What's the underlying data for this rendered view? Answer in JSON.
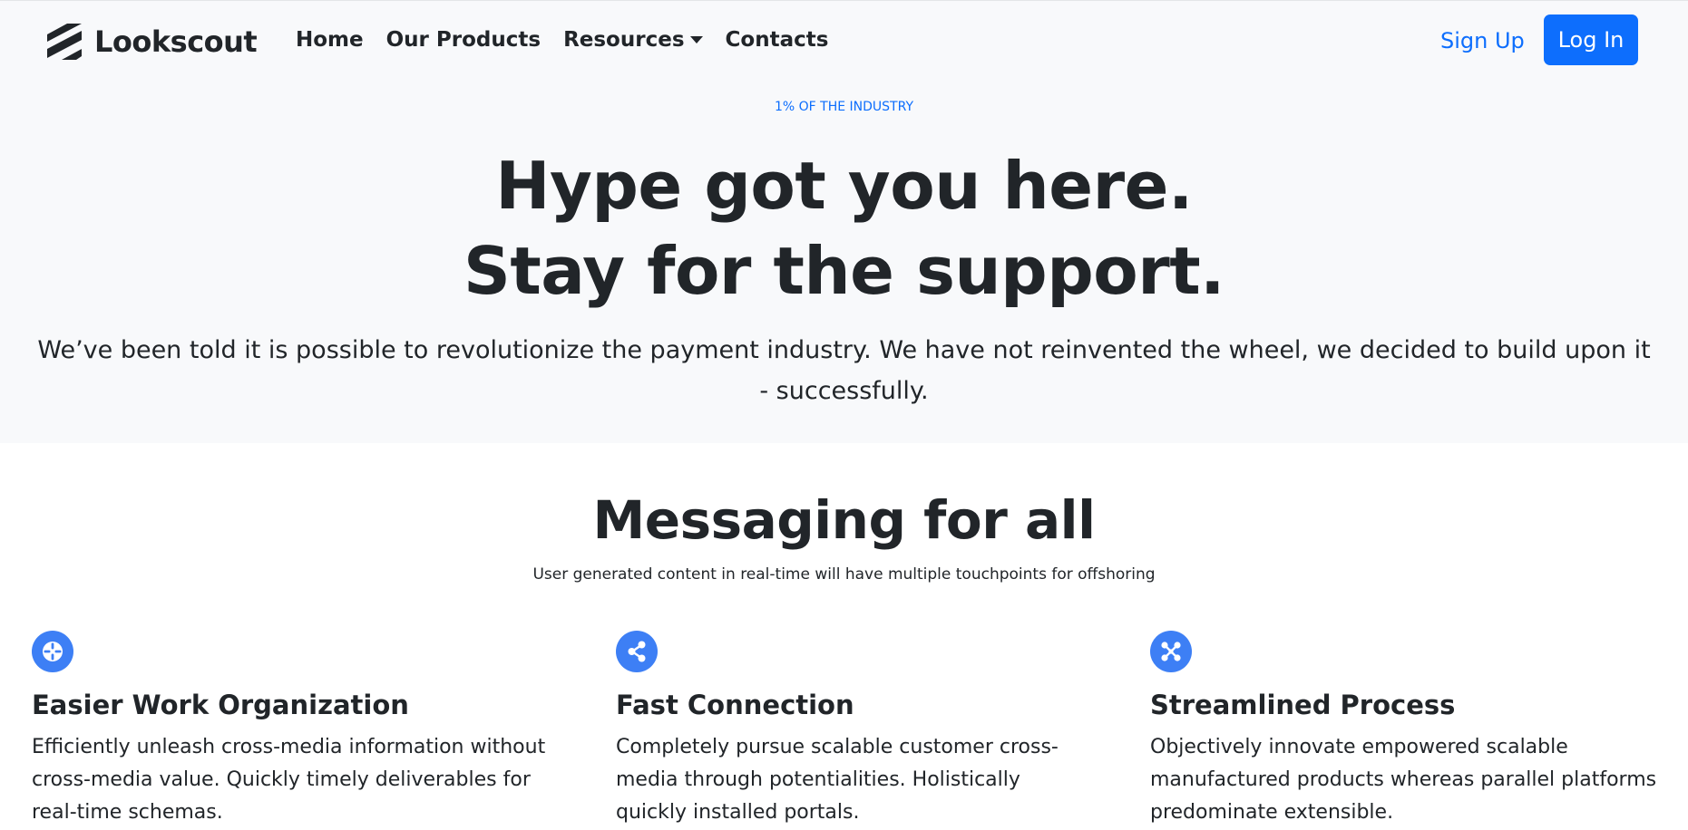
{
  "brand": {
    "name": "Lookscout",
    "logo_icon": "stripes-logo-icon"
  },
  "nav": {
    "items": [
      {
        "label": "Home"
      },
      {
        "label": "Our Products"
      },
      {
        "label": "Resources",
        "has_dropdown": true
      },
      {
        "label": "Contacts"
      }
    ],
    "signup_label": "Sign Up",
    "login_label": "Log In"
  },
  "hero": {
    "eyebrow": "1% of the industry",
    "title_line1": "Hype got you here.",
    "title_line2": "Stay for the support.",
    "subtitle": "We’ve been told it is possible to revolutionize the payment industry. We have not reinvented the wheel, we decided to build upon it - successfully."
  },
  "messaging": {
    "title": "Messaging for all",
    "subtitle": "User generated content in real-time will have multiple touchpoints for offshoring",
    "features": [
      {
        "icon": "crosshair-icon",
        "title": "Easier Work Organization",
        "text": "Efficiently unleash cross-media information without cross-media value. Quickly timely deliverables for real-time schemas."
      },
      {
        "icon": "share-icon",
        "title": "Fast Connection",
        "text": "Completely pursue scalable customer cross-media through potentialities. Holistically quickly installed portals."
      },
      {
        "icon": "nodes-icon",
        "title": "Streamlined Process",
        "text": "Objectively innovate empowered scalable manufactured products whereas parallel platforms predominate extensible."
      }
    ]
  },
  "colors": {
    "accent": "#0d6efd",
    "icon_bg": "#3d7ff5",
    "hero_bg": "#f8f9fb",
    "text": "#212529"
  }
}
